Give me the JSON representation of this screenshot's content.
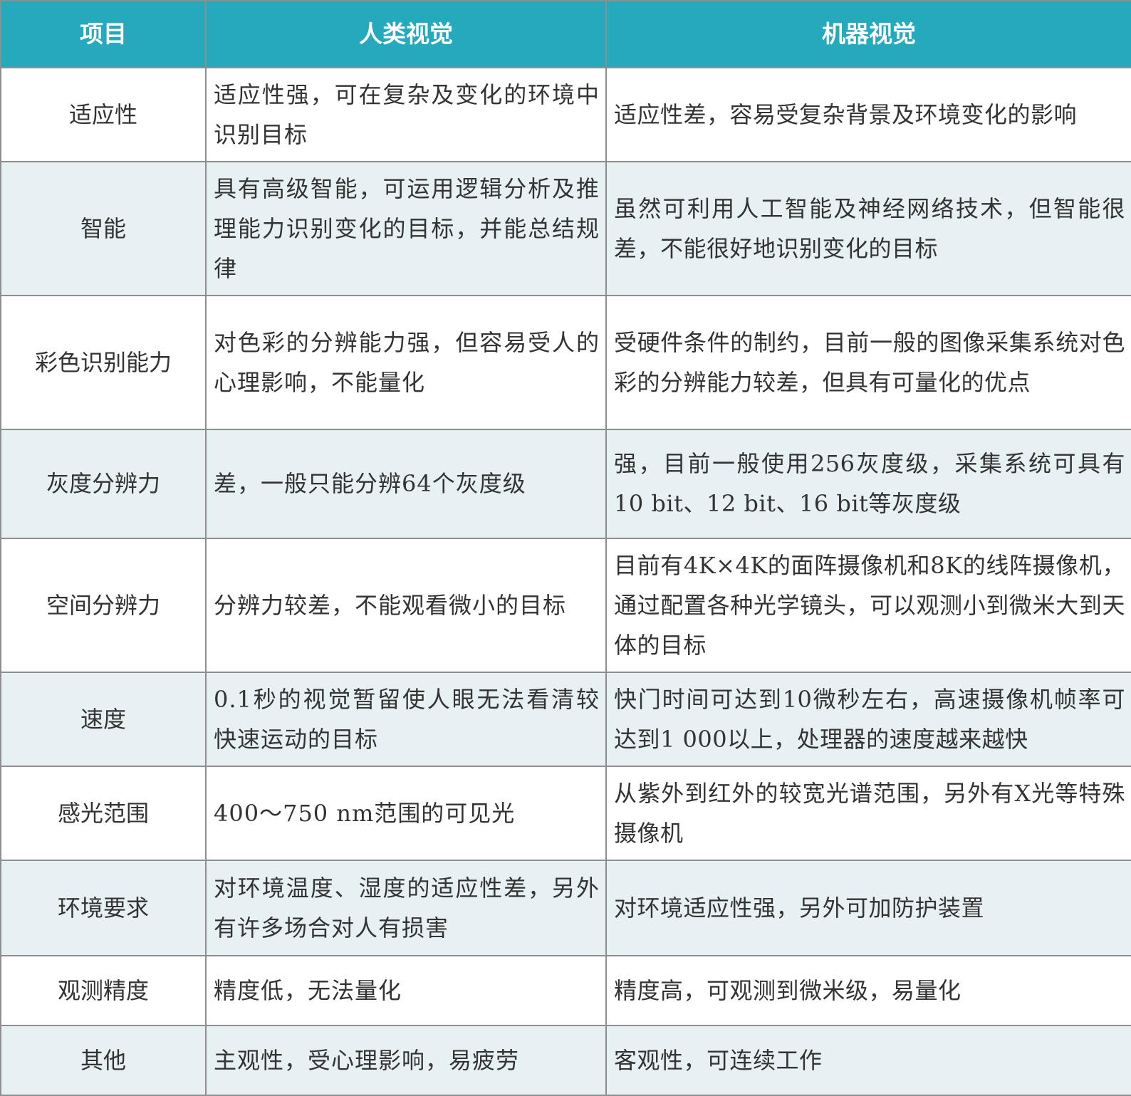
{
  "header": {
    "col_item": "项目",
    "col_human": "人类视觉",
    "col_machine": "机器视觉"
  },
  "rows": [
    {
      "item": "适应性",
      "human": "适应性强，可在复杂及变化的环境中识别目标",
      "machine": "适应性差，容易受复杂背景及环境变化的影响"
    },
    {
      "item": "智能",
      "human": "具有高级智能，可运用逻辑分析及推理能力识别变化的目标，并能总结规律",
      "machine": "虽然可利用人工智能及神经网络技术，但智能很差，不能很好地识别变化的目标"
    },
    {
      "item": "彩色识别能力",
      "human": "对色彩的分辨能力强，但容易受人的心理影响，不能量化",
      "machine": "受硬件条件的制约，目前一般的图像采集系统对色彩的分辨能力较差，但具有可量化的优点"
    },
    {
      "item": "灰度分辨力",
      "human": "差，一般只能分辨64个灰度级",
      "machine": "强，目前一般使用256灰度级，采集系统可具有10 bit、12 bit、16 bit等灰度级"
    },
    {
      "item": "空间分辨力",
      "human": "分辨力较差，不能观看微小的目标",
      "machine": "目前有4K×4K的面阵摄像机和8K的线阵摄像机，通过配置各种光学镜头，可以观测小到微米大到天体的目标"
    },
    {
      "item": "速度",
      "human": "0.1秒的视觉暂留使人眼无法看清较快速运动的目标",
      "machine": "快门时间可达到10微秒左右，高速摄像机帧率可达到1 000以上，处理器的速度越来越快"
    },
    {
      "item": "感光范围",
      "human": "400～750 nm范围的可见光",
      "machine": "从紫外到红外的较宽光谱范围，另外有X光等特殊摄像机"
    },
    {
      "item": "环境要求",
      "human": "对环境温度、湿度的适应性差，另外有许多场合对人有损害",
      "machine": "对环境适应性强，另外可加防护装置"
    },
    {
      "item": "观测精度",
      "human": "精度低，无法量化",
      "machine": "精度高，可观测到微米级，易量化"
    },
    {
      "item": "其他",
      "human": "主观性，受心理影响，易疲劳",
      "machine": "客观性，可连续工作"
    }
  ]
}
